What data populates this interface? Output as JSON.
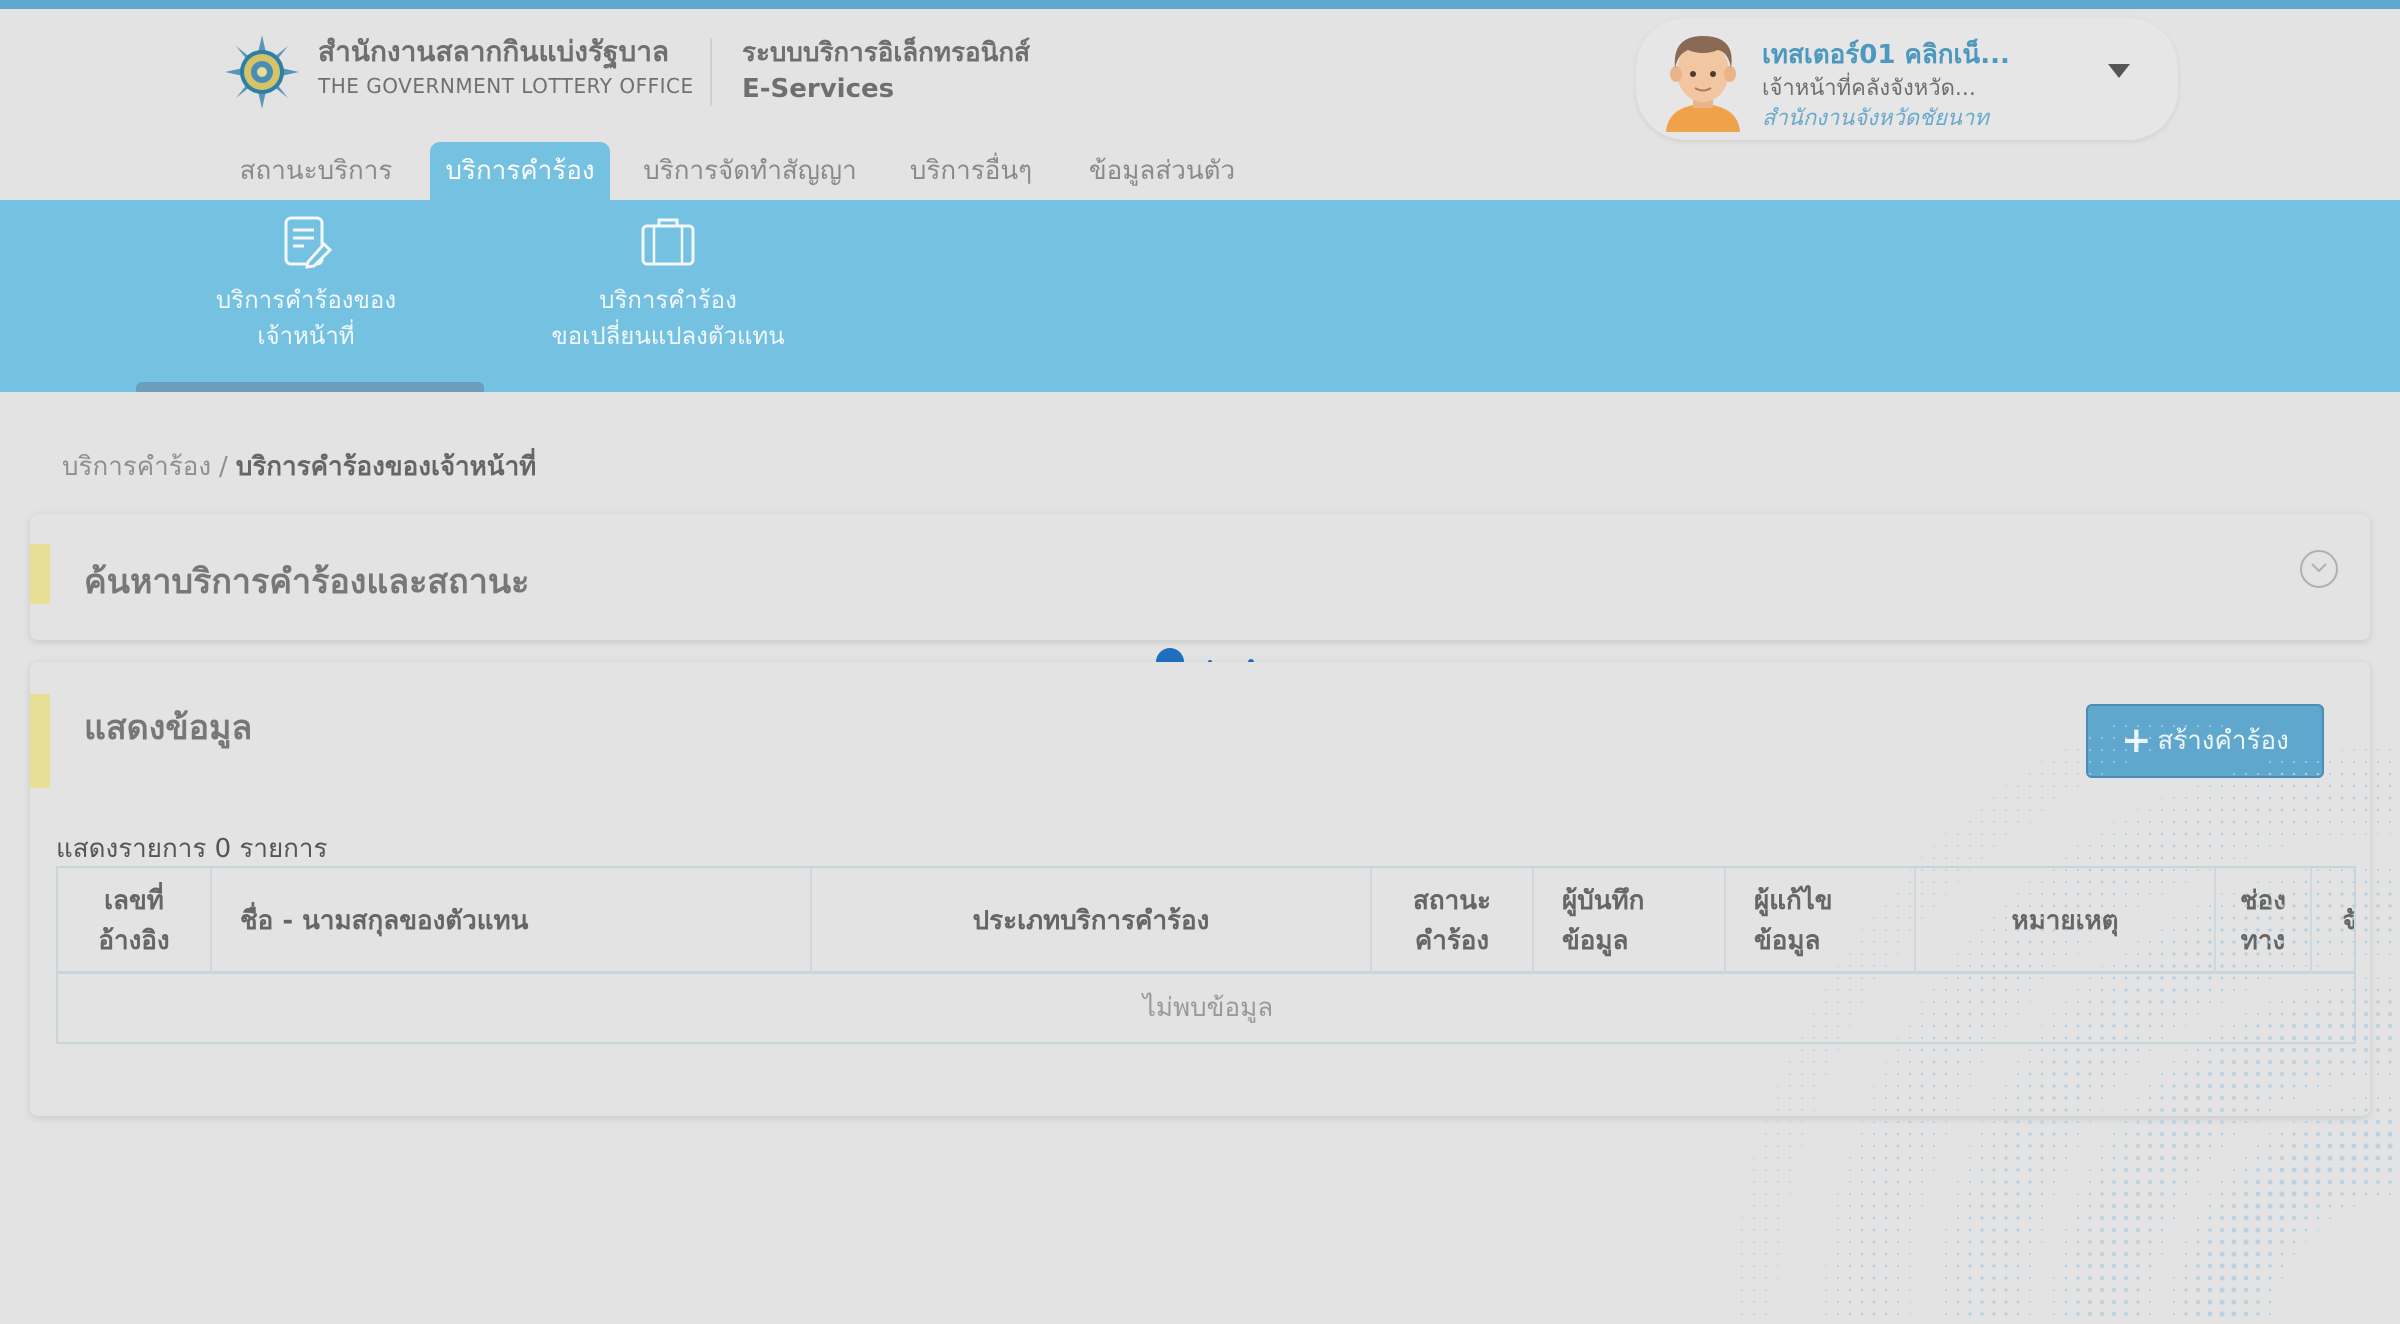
{
  "header": {
    "org_name_th": "สำนักงานสลากกินแบ่งรัฐบาล",
    "org_name_en": "THE GOVERNMENT LOTTERY OFFICE",
    "system_name_th": "ระบบบริการอิเล็กทรอนิกส์",
    "system_name_en": "E-Services",
    "brand_color": "#5fa7cc"
  },
  "user": {
    "name": "เทสเตอร์01 คลิกเน็...",
    "role": "เจ้าหน้าที่คลังจังหวัด...",
    "office": "สำนักงานจังหวัดชัยนาท"
  },
  "nav": {
    "tabs": [
      {
        "label": "สถานะบริการ"
      },
      {
        "label": "บริการคำร้อง"
      },
      {
        "label": "บริการจัดทำสัญญา"
      },
      {
        "label": "บริการอื่นๆ"
      },
      {
        "label": "ข้อมูลส่วนตัว"
      }
    ],
    "active_tab": "บริการคำร้อง"
  },
  "subnav": {
    "items": [
      {
        "line1": "บริการคำร้องของ",
        "line2": "เจ้าหน้าที่",
        "icon": "document-edit-icon"
      },
      {
        "line1": "บริการคำร้อง",
        "line2": "ขอเปลี่ยนแปลงตัวแทน",
        "icon": "briefcase-icon"
      }
    ]
  },
  "breadcrumb": {
    "parent": "บริการคำร้อง",
    "separator": "/",
    "current": "บริการคำร้องของเจ้าหน้าที่"
  },
  "search_section": {
    "title": "ค้นหาบริการคำร้องและสถานะ"
  },
  "data_section": {
    "title": "แสดงข้อมูล",
    "create_button": "สร้างคำร้อง",
    "count_text": "แสดงรายการ 0 รายการ",
    "columns": [
      {
        "l1": "เลขที่",
        "l2": "อ้างอิง"
      },
      {
        "l1": "ชื่อ - นามสกุลของตัวแทน",
        "l2": ""
      },
      {
        "l1": "ประเภทบริการคำร้อง",
        "l2": ""
      },
      {
        "l1": "สถานะ",
        "l2": "คำร้อง"
      },
      {
        "l1": "ผู้บันทึก",
        "l2": "ข้อมูล"
      },
      {
        "l1": "ผู้แก้ไข",
        "l2": "ข้อมูล"
      },
      {
        "l1": "หมายเหตุ",
        "l2": ""
      },
      {
        "l1": "ช่อง",
        "l2": "ทาง"
      },
      {
        "l1": "จั",
        "l2": ""
      }
    ],
    "empty_text": "ไม่พบข้อมูล"
  }
}
